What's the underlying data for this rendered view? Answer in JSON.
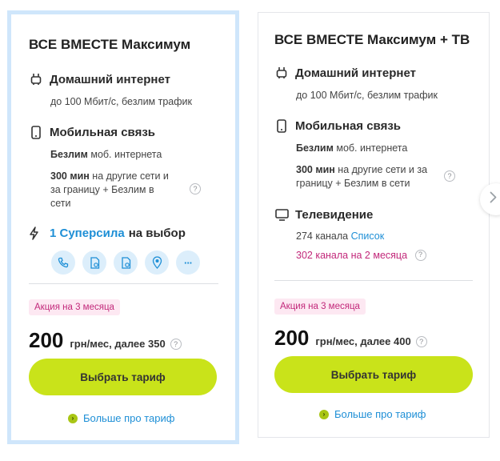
{
  "plans": [
    {
      "title": "ВСЕ ВМЕСТЕ Максимум",
      "internet": {
        "label": "Домашний интернет",
        "detail": "до 100 Мбит/с, безлим трафик"
      },
      "mobile": {
        "label": "Мобильная связь",
        "data_bold": "Безлим",
        "data_rest": "моб. интернета",
        "minutes_bold": "300 мин",
        "minutes_rest_1": "на другие сети и",
        "minutes_rest_2": "за границу + Безлим в",
        "minutes_rest_3": "сети",
        "help": "?"
      },
      "superpower": {
        "highlight": "1 Суперсила",
        "rest": "на выбор",
        "options": [
          "phone-icon",
          "sim-card-icon",
          "sim-card-icon",
          "location-pin-icon",
          "more-icon"
        ],
        "more": "···"
      },
      "promo": "Акция на 3 месяца",
      "price": {
        "value": "200",
        "period": "грн/мес, далее 350",
        "help": "?"
      },
      "cta": "Выбрать тариф",
      "more_link": "Больше про тариф"
    },
    {
      "title": "ВСЕ ВМЕСТЕ Максимум + ТВ",
      "internet": {
        "label": "Домашний интернет",
        "detail": "до 100 Мбит/с, безлим трафик"
      },
      "mobile": {
        "label": "Мобильная связь",
        "data_bold": "Безлим",
        "data_rest": "моб. интернета",
        "minutes_bold": "300 мин",
        "minutes_rest_1": "на другие сети и за",
        "minutes_rest_2": "границу + Безлим в сети",
        "help": "?"
      },
      "tv": {
        "label": "Телевидение",
        "channels": "274 канала",
        "list_link": "Список",
        "promo_channels": "302 канала на 2 месяца",
        "help": "?"
      },
      "promo": "Акция на 3 месяца",
      "price": {
        "value": "200",
        "period": "грн/мес, далее 400",
        "help": "?"
      },
      "cta": "Выбрать тариф",
      "more_link": "Больше про тариф"
    }
  ],
  "icons": {
    "next": "chevron-right-icon",
    "more_arrow": "›"
  },
  "colors": {
    "accent_green": "#c9e31a",
    "link_blue": "#1e8fd6",
    "promo_pink": "#c2287a",
    "selected_border": "#cfe6fb"
  }
}
